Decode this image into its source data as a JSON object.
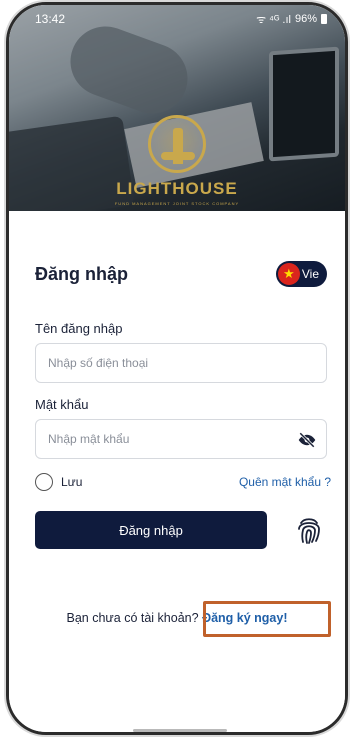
{
  "status_bar": {
    "time": "13:42",
    "battery": "96%",
    "signal": "ᯤ ⁴ᴳ .ıl"
  },
  "brand": {
    "name": "LIGHTHOUSE",
    "tagline": "FUND MANAGEMENT JOINT STOCK COMPANY"
  },
  "login": {
    "title": "Đăng nhập",
    "language_label": "Vie",
    "username_label": "Tên đăng nhập",
    "username_placeholder": "Nhập số điện thoại",
    "password_label": "Mật khẩu",
    "password_placeholder": "Nhập mật khẩu",
    "remember_label": "Lưu",
    "forgot_label": "Quên mật khẩu ?",
    "submit_label": "Đăng nhập"
  },
  "signup": {
    "prompt": "Bạn chưa có tài khoản?",
    "link_label": "Đăng ký ngay!"
  },
  "colors": {
    "primary": "#0f1b3d",
    "link": "#1f5fa8",
    "gold": "#c9a84c",
    "highlight": "#c0612b"
  },
  "icons": {
    "flag": "vietnam-flag-icon",
    "password_toggle": "eye-slash-icon",
    "biometric": "fingerprint-icon"
  }
}
